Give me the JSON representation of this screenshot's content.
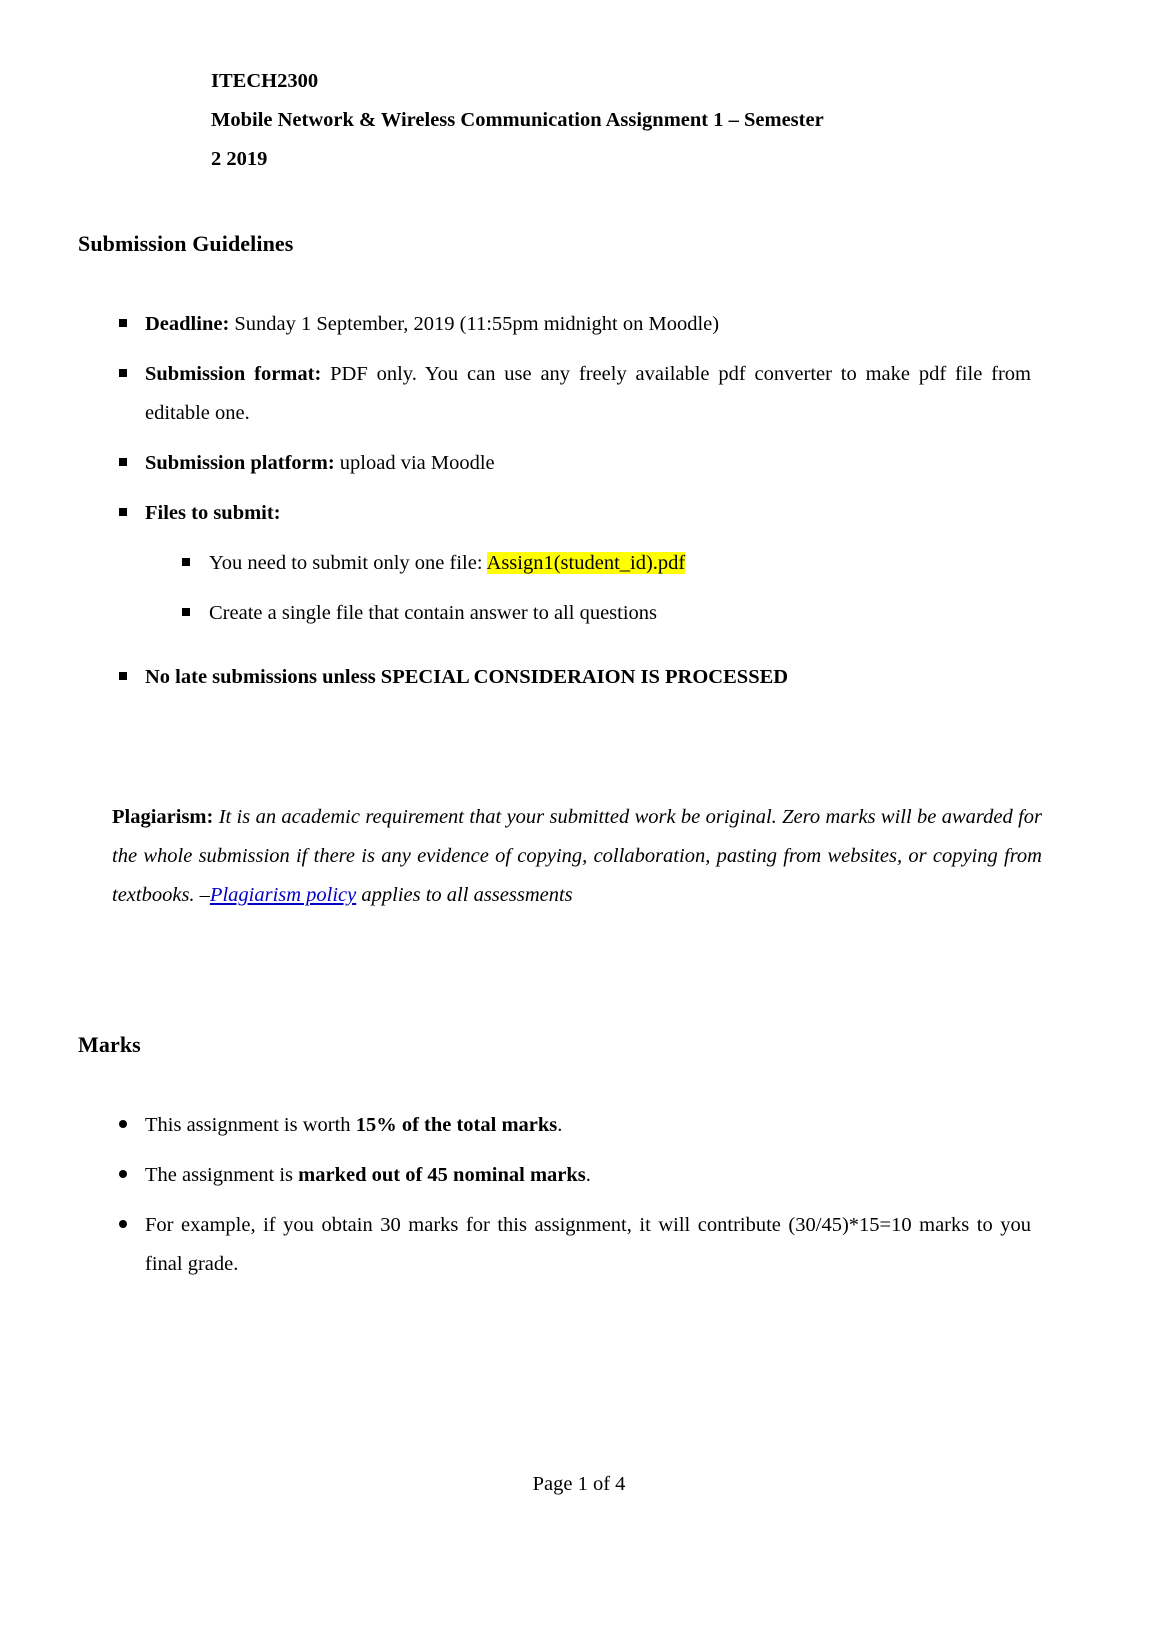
{
  "document": {
    "course_code": "ITECH2300",
    "title_line_1": "Mobile Network & Wireless Communication Assignment 1 – Semester",
    "title_line_2": "2 2019"
  },
  "submission": {
    "heading": "Submission Guidelines",
    "items": [
      {
        "marker": "square-bullet",
        "level": 1,
        "lead": "Deadline:",
        "text": " Sunday 1 September, 2019 (11:55pm midnight on Moodle)"
      },
      {
        "marker": "square-bullet",
        "level": 1,
        "lead": "Submission format:",
        "text": " PDF only. You can use any freely available pdf converter to make pdf file from editable one."
      },
      {
        "marker": "square-bullet",
        "level": 1,
        "lead": "Submission platform:",
        "text": " upload via Moodle"
      },
      {
        "marker": "square-bullet",
        "level": 1,
        "lead": "Files to submit:",
        "text": ""
      },
      {
        "marker": "square-bullet",
        "level": 2,
        "lead": "",
        "text": "You need to submit only one file: ",
        "highlight": "Assign1(student_id).pdf"
      },
      {
        "marker": "square-bullet",
        "level": 2,
        "lead": "",
        "text": "Create a single file that contain answer to all questions"
      },
      {
        "marker": "square-bullet",
        "level": 1,
        "bold_all": true,
        "lead": "",
        "text": "No late submissions unless SPECIAL CONSIDERAION IS PROCESSED"
      }
    ]
  },
  "plagiarism": {
    "lead": "Plagiarism:",
    "text_before_link": " It is an academic requirement that your submitted work be original. Zero marks will be awarded for the whole submission if there is any evidence of copying, collaboration, pasting from websites, or copying from textbooks. –",
    "link_text": "Plagiarism policy",
    "text_after_link": " applies to all assessments"
  },
  "marks": {
    "heading": "Marks",
    "items": [
      {
        "marker": "round-bullet",
        "text_before_bold": "This assignment is worth ",
        "bold_text": "15% of the total marks",
        "text_after_bold": "."
      },
      {
        "marker": "round-bullet",
        "text_before_bold": "The assignment is ",
        "bold_text": "marked out of 45 nominal marks",
        "text_after_bold": "."
      },
      {
        "marker": "round-bullet",
        "text_before_bold": "For example, if you obtain 30 marks for this assignment, it will contribute (30/45)*15=10 marks to you final grade.",
        "bold_text": "",
        "text_after_bold": ""
      }
    ]
  },
  "footer": {
    "page_indicator": "Page 1 of 4"
  },
  "colors": {
    "highlight": "#ffff00",
    "link": "#0000c8",
    "text": "#000000",
    "background": "#ffffff"
  }
}
